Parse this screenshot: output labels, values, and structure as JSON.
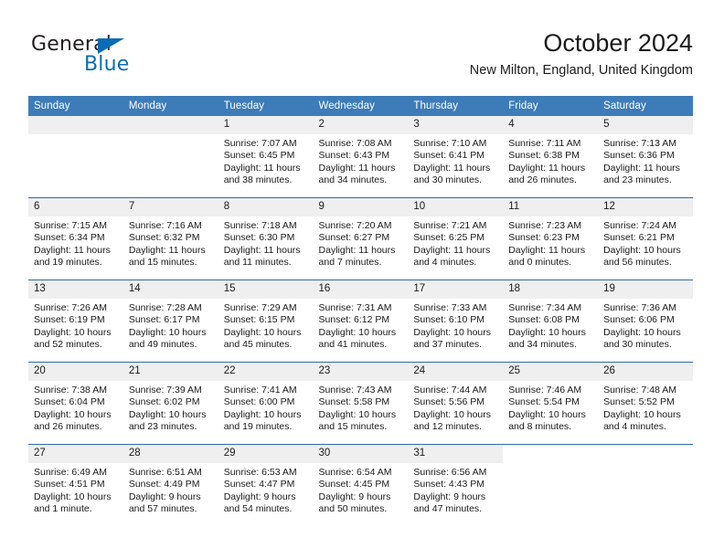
{
  "brand": {
    "name_part1": "General",
    "name_part2": "Blue",
    "accent_color": "#0a6cb5"
  },
  "header": {
    "month_title": "October 2024",
    "location": "New Milton, England, United Kingdom"
  },
  "calendar": {
    "header_bg": "#3d7cb8",
    "row_divider": "#2d6ca8",
    "daynum_bg": "#efefef",
    "weekdays": [
      "Sunday",
      "Monday",
      "Tuesday",
      "Wednesday",
      "Thursday",
      "Friday",
      "Saturday"
    ],
    "weeks": [
      [
        {
          "day": "",
          "empty": true,
          "shaded": true
        },
        {
          "day": "",
          "empty": true,
          "shaded": true
        },
        {
          "day": "1",
          "sunrise": "Sunrise: 7:07 AM",
          "sunset": "Sunset: 6:45 PM",
          "daylight": "Daylight: 11 hours and 38 minutes."
        },
        {
          "day": "2",
          "sunrise": "Sunrise: 7:08 AM",
          "sunset": "Sunset: 6:43 PM",
          "daylight": "Daylight: 11 hours and 34 minutes."
        },
        {
          "day": "3",
          "sunrise": "Sunrise: 7:10 AM",
          "sunset": "Sunset: 6:41 PM",
          "daylight": "Daylight: 11 hours and 30 minutes."
        },
        {
          "day": "4",
          "sunrise": "Sunrise: 7:11 AM",
          "sunset": "Sunset: 6:38 PM",
          "daylight": "Daylight: 11 hours and 26 minutes."
        },
        {
          "day": "5",
          "sunrise": "Sunrise: 7:13 AM",
          "sunset": "Sunset: 6:36 PM",
          "daylight": "Daylight: 11 hours and 23 minutes."
        }
      ],
      [
        {
          "day": "6",
          "sunrise": "Sunrise: 7:15 AM",
          "sunset": "Sunset: 6:34 PM",
          "daylight": "Daylight: 11 hours and 19 minutes."
        },
        {
          "day": "7",
          "sunrise": "Sunrise: 7:16 AM",
          "sunset": "Sunset: 6:32 PM",
          "daylight": "Daylight: 11 hours and 15 minutes."
        },
        {
          "day": "8",
          "sunrise": "Sunrise: 7:18 AM",
          "sunset": "Sunset: 6:30 PM",
          "daylight": "Daylight: 11 hours and 11 minutes."
        },
        {
          "day": "9",
          "sunrise": "Sunrise: 7:20 AM",
          "sunset": "Sunset: 6:27 PM",
          "daylight": "Daylight: 11 hours and 7 minutes."
        },
        {
          "day": "10",
          "sunrise": "Sunrise: 7:21 AM",
          "sunset": "Sunset: 6:25 PM",
          "daylight": "Daylight: 11 hours and 4 minutes."
        },
        {
          "day": "11",
          "sunrise": "Sunrise: 7:23 AM",
          "sunset": "Sunset: 6:23 PM",
          "daylight": "Daylight: 11 hours and 0 minutes."
        },
        {
          "day": "12",
          "sunrise": "Sunrise: 7:24 AM",
          "sunset": "Sunset: 6:21 PM",
          "daylight": "Daylight: 10 hours and 56 minutes."
        }
      ],
      [
        {
          "day": "13",
          "sunrise": "Sunrise: 7:26 AM",
          "sunset": "Sunset: 6:19 PM",
          "daylight": "Daylight: 10 hours and 52 minutes."
        },
        {
          "day": "14",
          "sunrise": "Sunrise: 7:28 AM",
          "sunset": "Sunset: 6:17 PM",
          "daylight": "Daylight: 10 hours and 49 minutes."
        },
        {
          "day": "15",
          "sunrise": "Sunrise: 7:29 AM",
          "sunset": "Sunset: 6:15 PM",
          "daylight": "Daylight: 10 hours and 45 minutes."
        },
        {
          "day": "16",
          "sunrise": "Sunrise: 7:31 AM",
          "sunset": "Sunset: 6:12 PM",
          "daylight": "Daylight: 10 hours and 41 minutes."
        },
        {
          "day": "17",
          "sunrise": "Sunrise: 7:33 AM",
          "sunset": "Sunset: 6:10 PM",
          "daylight": "Daylight: 10 hours and 37 minutes."
        },
        {
          "day": "18",
          "sunrise": "Sunrise: 7:34 AM",
          "sunset": "Sunset: 6:08 PM",
          "daylight": "Daylight: 10 hours and 34 minutes."
        },
        {
          "day": "19",
          "sunrise": "Sunrise: 7:36 AM",
          "sunset": "Sunset: 6:06 PM",
          "daylight": "Daylight: 10 hours and 30 minutes."
        }
      ],
      [
        {
          "day": "20",
          "sunrise": "Sunrise: 7:38 AM",
          "sunset": "Sunset: 6:04 PM",
          "daylight": "Daylight: 10 hours and 26 minutes."
        },
        {
          "day": "21",
          "sunrise": "Sunrise: 7:39 AM",
          "sunset": "Sunset: 6:02 PM",
          "daylight": "Daylight: 10 hours and 23 minutes."
        },
        {
          "day": "22",
          "sunrise": "Sunrise: 7:41 AM",
          "sunset": "Sunset: 6:00 PM",
          "daylight": "Daylight: 10 hours and 19 minutes."
        },
        {
          "day": "23",
          "sunrise": "Sunrise: 7:43 AM",
          "sunset": "Sunset: 5:58 PM",
          "daylight": "Daylight: 10 hours and 15 minutes."
        },
        {
          "day": "24",
          "sunrise": "Sunrise: 7:44 AM",
          "sunset": "Sunset: 5:56 PM",
          "daylight": "Daylight: 10 hours and 12 minutes."
        },
        {
          "day": "25",
          "sunrise": "Sunrise: 7:46 AM",
          "sunset": "Sunset: 5:54 PM",
          "daylight": "Daylight: 10 hours and 8 minutes."
        },
        {
          "day": "26",
          "sunrise": "Sunrise: 7:48 AM",
          "sunset": "Sunset: 5:52 PM",
          "daylight": "Daylight: 10 hours and 4 minutes."
        }
      ],
      [
        {
          "day": "27",
          "sunrise": "Sunrise: 6:49 AM",
          "sunset": "Sunset: 4:51 PM",
          "daylight": "Daylight: 10 hours and 1 minute."
        },
        {
          "day": "28",
          "sunrise": "Sunrise: 6:51 AM",
          "sunset": "Sunset: 4:49 PM",
          "daylight": "Daylight: 9 hours and 57 minutes."
        },
        {
          "day": "29",
          "sunrise": "Sunrise: 6:53 AM",
          "sunset": "Sunset: 4:47 PM",
          "daylight": "Daylight: 9 hours and 54 minutes."
        },
        {
          "day": "30",
          "sunrise": "Sunrise: 6:54 AM",
          "sunset": "Sunset: 4:45 PM",
          "daylight": "Daylight: 9 hours and 50 minutes."
        },
        {
          "day": "31",
          "sunrise": "Sunrise: 6:56 AM",
          "sunset": "Sunset: 4:43 PM",
          "daylight": "Daylight: 9 hours and 47 minutes."
        },
        {
          "day": "",
          "empty": true,
          "shaded": false
        },
        {
          "day": "",
          "empty": true,
          "shaded": false
        }
      ]
    ]
  }
}
